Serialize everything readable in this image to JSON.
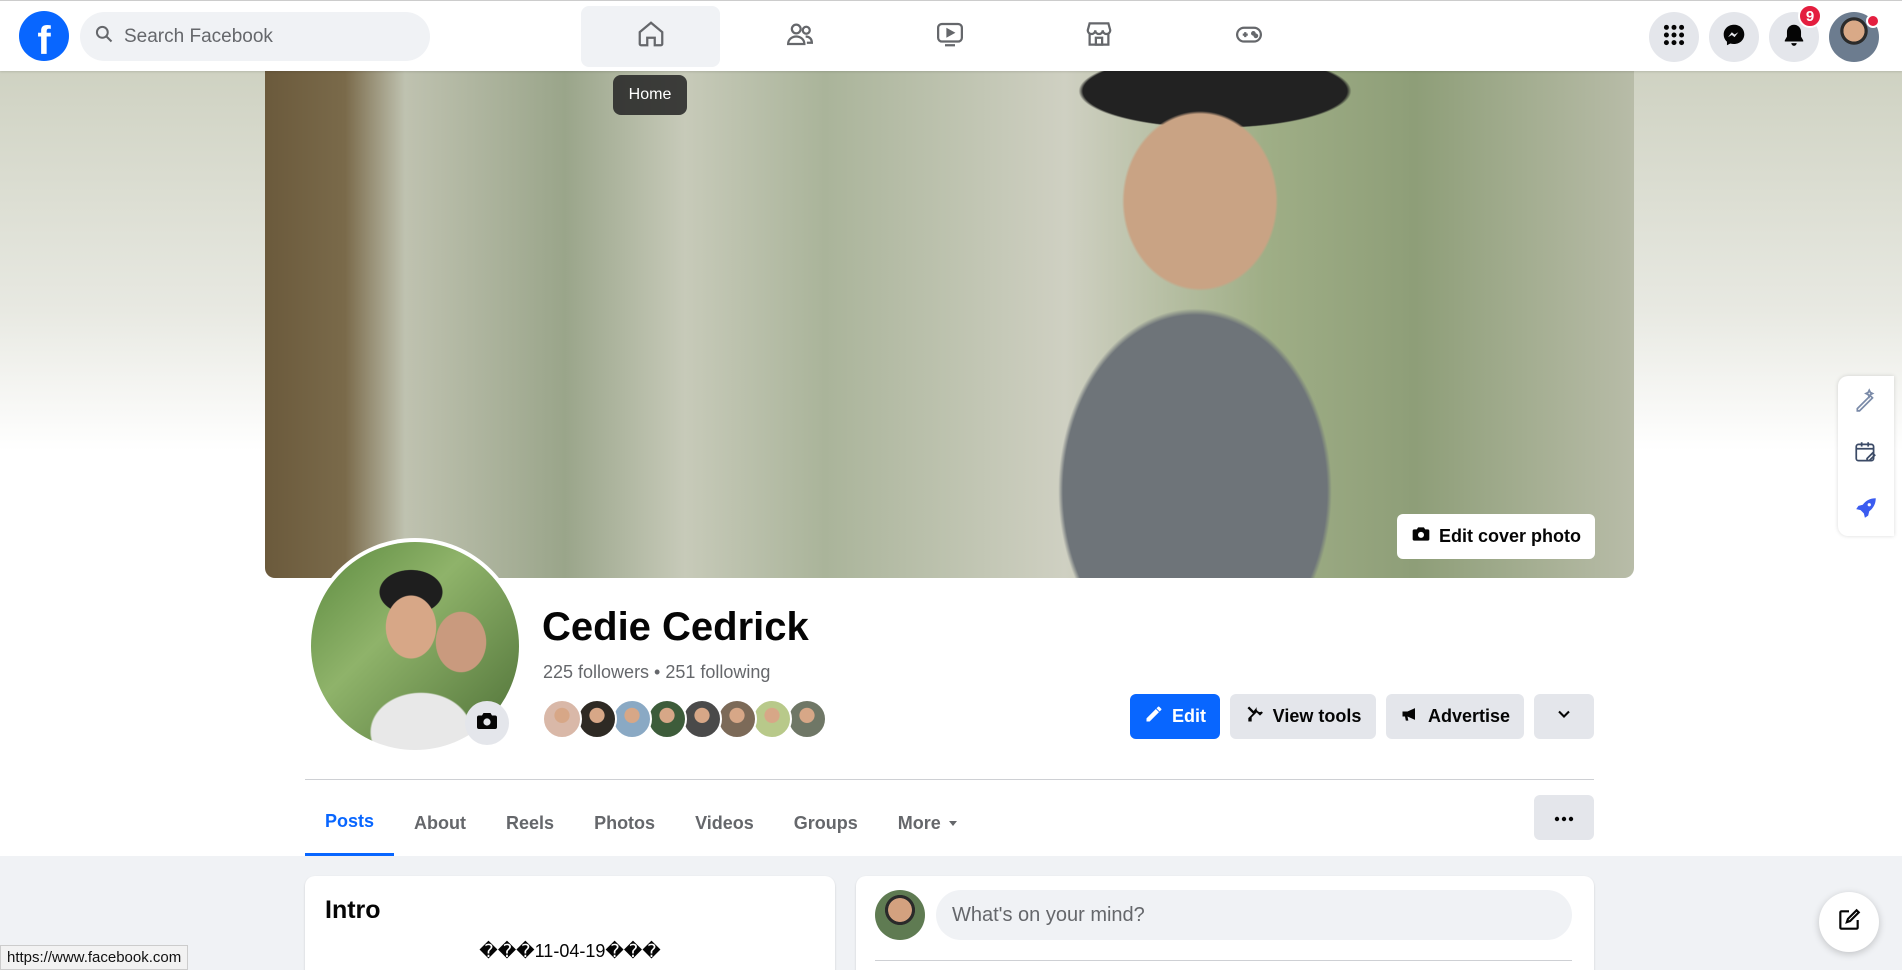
{
  "brand": {
    "logo_letter": "f",
    "color": "#0866ff"
  },
  "search": {
    "placeholder": "Search Facebook",
    "icon": "search-icon"
  },
  "nav": {
    "tabs": [
      {
        "name": "home",
        "icon": "home-icon",
        "active": true
      },
      {
        "name": "friends",
        "icon": "friends-icon",
        "active": false
      },
      {
        "name": "video",
        "icon": "video-icon",
        "active": false
      },
      {
        "name": "marketplace",
        "icon": "marketplace-icon",
        "active": false
      },
      {
        "name": "gaming",
        "icon": "gaming-icon",
        "active": false
      }
    ],
    "tooltip": "Home"
  },
  "right_nav": {
    "menu_icon": "grid-menu-icon",
    "messenger_icon": "messenger-icon",
    "notifications_icon": "bell-icon",
    "notification_count": "9"
  },
  "profile": {
    "name": "Cedie Cedrick",
    "followers_text": "225 followers • 251 following",
    "edit_cover_label": "Edit cover photo",
    "friend_avatar_colors": [
      "#d9b8a8",
      "#2e2a24",
      "#8aa9c4",
      "#3d5c3a",
      "#4a4a4a",
      "#7c6a58",
      "#b8c98a",
      "#6f7766"
    ]
  },
  "actions": {
    "edit_label": "Edit",
    "view_tools_label": "View tools",
    "advertise_label": "Advertise"
  },
  "tabs": [
    {
      "label": "Posts",
      "active": true
    },
    {
      "label": "About",
      "active": false
    },
    {
      "label": "Reels",
      "active": false
    },
    {
      "label": "Photos",
      "active": false
    },
    {
      "label": "Videos",
      "active": false
    },
    {
      "label": "Groups",
      "active": false
    },
    {
      "label": "More",
      "active": false
    }
  ],
  "intro": {
    "title": "Intro",
    "bio": "���11-04-19���"
  },
  "composer": {
    "placeholder": "What's on your mind?"
  },
  "status_bar": {
    "url": "https://www.facebook.com"
  }
}
